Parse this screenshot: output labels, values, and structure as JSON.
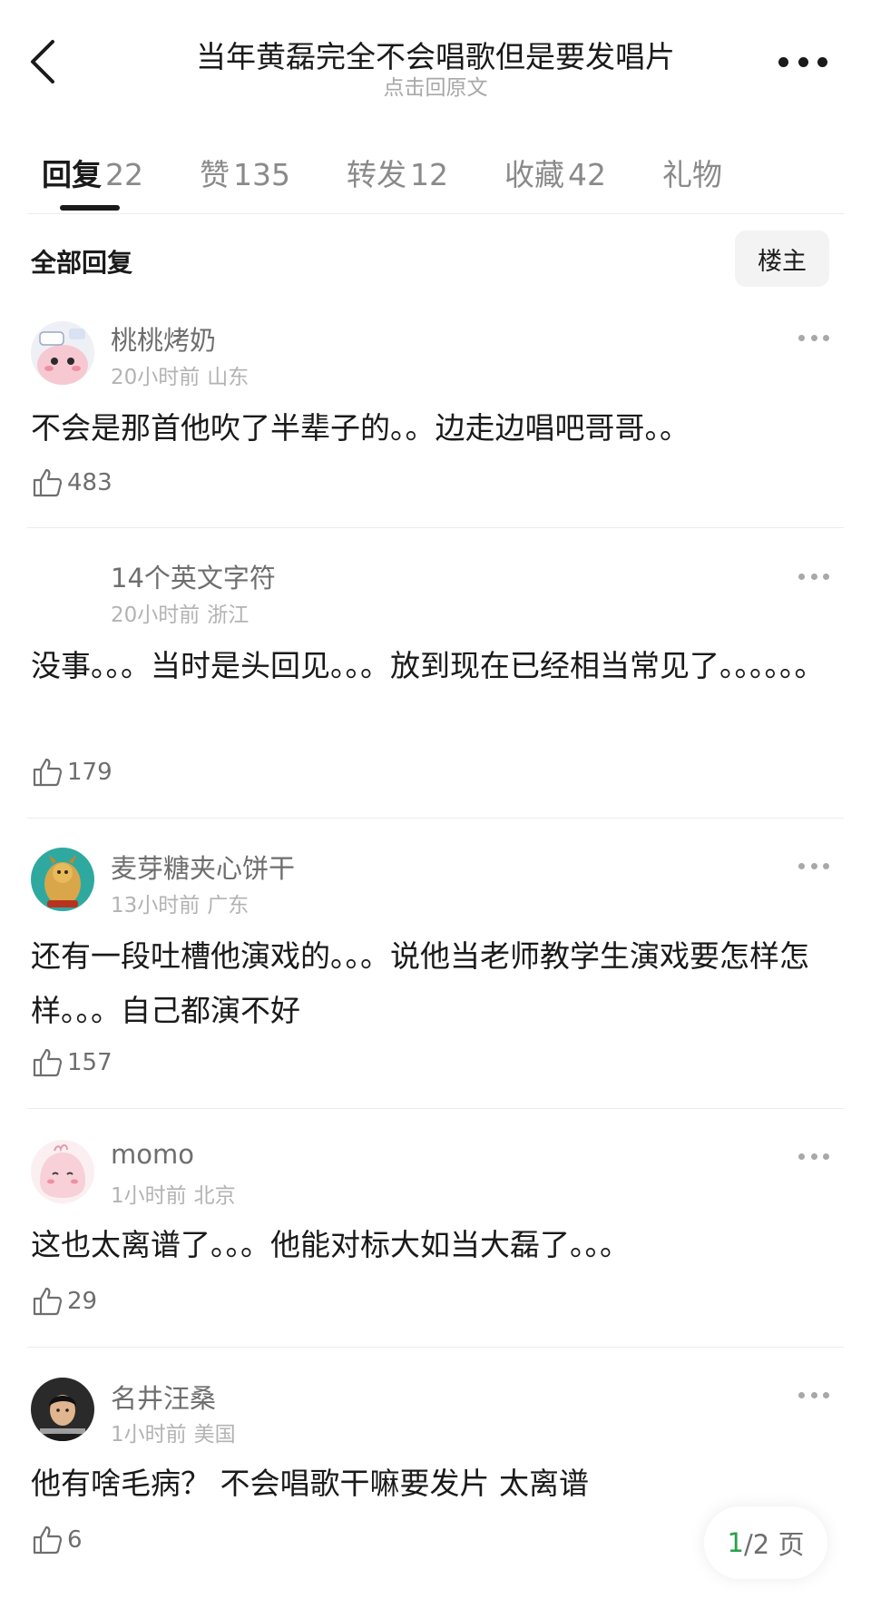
{
  "header": {
    "title": "当年黄磊完全不会唱歌但是要发唱片",
    "subtitle": "点击回原文"
  },
  "tabs": [
    {
      "label": "回复",
      "count": "22"
    },
    {
      "label": "赞",
      "count": "135"
    },
    {
      "label": "转发",
      "count": "12"
    },
    {
      "label": "收藏",
      "count": "42"
    },
    {
      "label": "礼物",
      "count": ""
    }
  ],
  "section": {
    "title": "全部回复",
    "filter_label": "楼主"
  },
  "comments": [
    {
      "username": "桃桃烤奶",
      "time": "20小时前",
      "location": "山东",
      "text": "不会是那首他吹了半辈子的。。边走边唱吧哥哥。。",
      "likes": "483",
      "avatar_icon": "pink-cartoon-avatar"
    },
    {
      "username": "14个英文字符",
      "time": "20小时前",
      "location": "浙江",
      "text": "没事。。。当时是头回见。。。放到现在已经相当常见了。。。。。。",
      "likes": "179",
      "avatar_icon": "blank-avatar"
    },
    {
      "username": "麦芽糖夹心饼干",
      "time": "13小时前",
      "location": "广东",
      "text": "还有一段吐槽他演戏的。。。说他当老师教学生演戏要怎样怎样。。。自己都演不好",
      "likes": "157",
      "avatar_icon": "dragon-avatar"
    },
    {
      "username": "momo",
      "time": "1小时前",
      "location": "北京",
      "text": "这也太离谱了。。。他能对标大如当大磊了。。。",
      "likes": "29",
      "avatar_icon": "pink-blob-avatar"
    },
    {
      "username": "名井汪桑",
      "time": "1小时前",
      "location": "美国",
      "text": "他有啥毛病？ 不会唱歌干嘛要发片 太离谱",
      "likes": "6",
      "avatar_icon": "person-photo-avatar"
    }
  ],
  "pager": {
    "current": "1",
    "total_text": "/2 页"
  },
  "colors": {
    "text_primary": "#1a1a1a",
    "text_secondary": "#6e6e6e",
    "text_muted": "#b3b3b3",
    "pager_accent": "#2aa04a"
  }
}
